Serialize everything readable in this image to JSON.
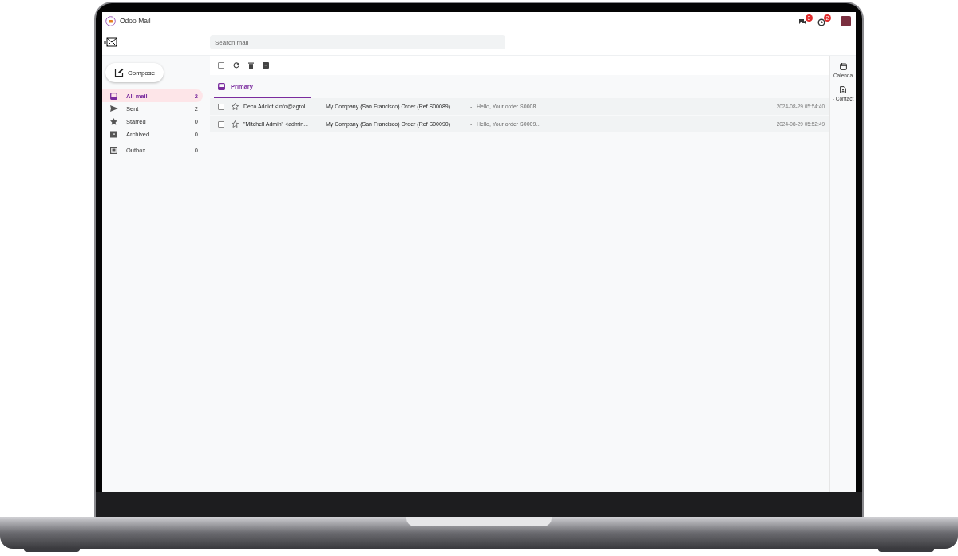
{
  "app": {
    "title": "Odoo Mail"
  },
  "header": {
    "badges": [
      {
        "count": "3"
      },
      {
        "count": "2"
      }
    ]
  },
  "search": {
    "placeholder": "Search mail"
  },
  "compose": {
    "label": "Compose"
  },
  "folders": [
    {
      "label": "All mail",
      "count": "2",
      "selected": true
    },
    {
      "label": "Sent",
      "count": "2",
      "selected": false
    },
    {
      "label": "Starred",
      "count": "0",
      "selected": false
    },
    {
      "label": "Archived",
      "count": "0",
      "selected": false
    },
    {
      "label": "Outbox",
      "count": "0",
      "selected": false
    }
  ],
  "toolbar": {
    "select_all_checked": false
  },
  "tabs": [
    {
      "label": "Primary",
      "selected": true
    }
  ],
  "messages": [
    {
      "checked": false,
      "starred": false,
      "sender": "Deco Addict <info@agrol...",
      "subject": "My Company (San Francisco) Order (Ref S00089)",
      "separator": "-",
      "snippet": "Hello, Your order S0008...",
      "date": "2024-08-29 05:54:40"
    },
    {
      "checked": false,
      "starred": false,
      "sender": "\"Mitchell Admin\" <admin...",
      "subject": "My Company (San Francisco) Order (Ref S00090)",
      "separator": "-",
      "snippet": "Hello, Your order S0009...",
      "date": "2024-08-29 05:52:49"
    }
  ],
  "side_apps": [
    {
      "label": "Calenda"
    },
    {
      "label": "- Contact"
    }
  ]
}
